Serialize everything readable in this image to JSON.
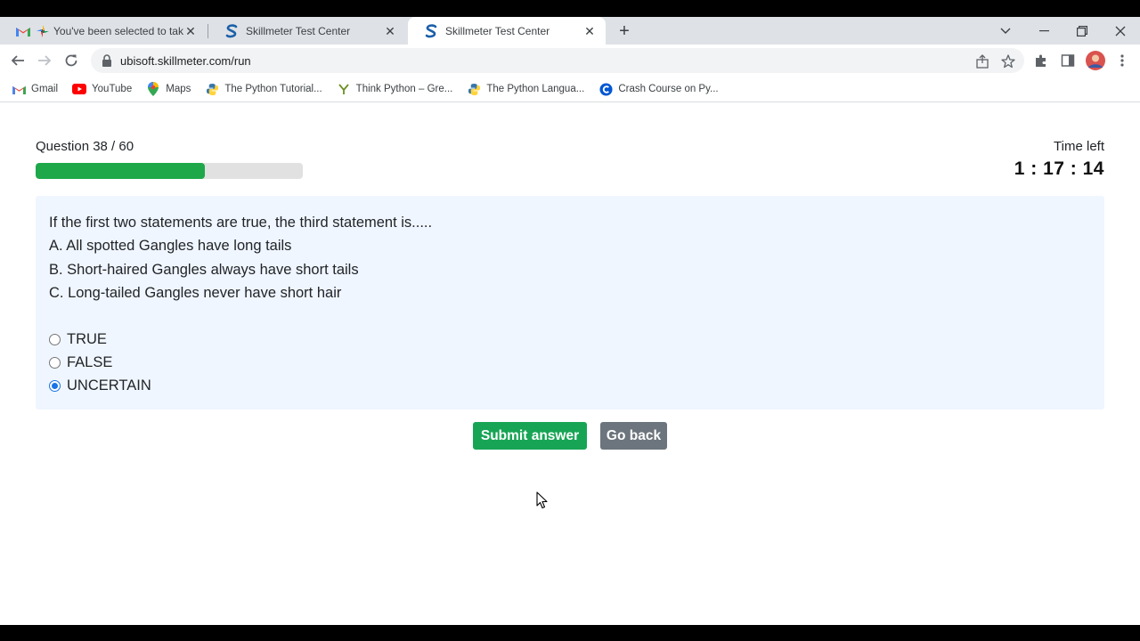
{
  "tabs": [
    {
      "title": "You've been selected to take",
      "active": false
    },
    {
      "title": "Skillmeter Test Center",
      "active": false
    },
    {
      "title": "Skillmeter Test Center",
      "active": true
    }
  ],
  "address_bar": {
    "url": "ubisoft.skillmeter.com/run"
  },
  "bookmarks": [
    {
      "label": "Gmail",
      "icon": "gmail-icon"
    },
    {
      "label": "YouTube",
      "icon": "youtube-icon"
    },
    {
      "label": "Maps",
      "icon": "maps-icon"
    },
    {
      "label": "The Python Tutorial...",
      "icon": "python-icon"
    },
    {
      "label": "Think Python – Gre...",
      "icon": "think-python-icon"
    },
    {
      "label": "The Python Langua...",
      "icon": "python-icon"
    },
    {
      "label": "Crash Course on Py...",
      "icon": "coursera-icon"
    }
  ],
  "quiz": {
    "counter": "Question 38 / 60",
    "progress_fraction": 0.633,
    "time_label": "Time left",
    "time_value": "1 : 17 : 14",
    "question_lines": [
      "If the first two statements are true, the third statement is.....",
      "A. All spotted Gangles have long tails",
      "B. Short-haired Gangles always have short tails",
      "C. Long-tailed Gangles never have short hair"
    ],
    "options": [
      {
        "label": "TRUE",
        "checked": false
      },
      {
        "label": "FALSE",
        "checked": false
      },
      {
        "label": "UNCERTAIN",
        "checked": true
      }
    ],
    "submit_label": "Submit answer",
    "back_label": "Go back"
  },
  "colors": {
    "progress_fill": "#1ea84a",
    "submit_button": "#17a555",
    "back_button": "#6c757d",
    "question_background": "#f0f6ff",
    "radio_accent": "#1a73e8"
  }
}
